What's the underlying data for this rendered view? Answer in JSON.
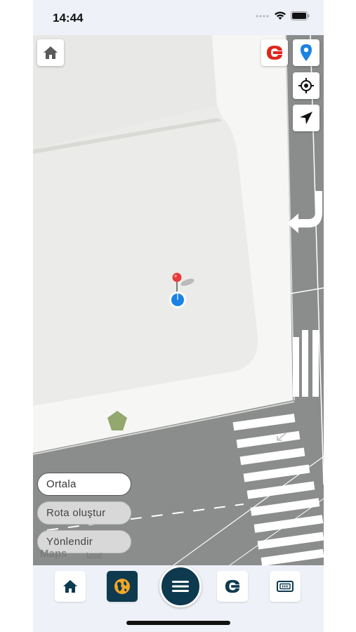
{
  "status_bar": {
    "time": "14:44",
    "icons": [
      "signal-dots-icon",
      "wifi-icon",
      "battery-icon"
    ]
  },
  "map": {
    "top_left_button_icon": "home-icon",
    "right_buttons": [
      "brand-logo-icon",
      "location-pin-icon",
      "crosshair-icon",
      "navigation-arrow-icon"
    ],
    "markers": [
      "red-pin-icon",
      "user-location-dot-icon"
    ],
    "attribution": {
      "logo": "Maps",
      "legal": "Legal"
    }
  },
  "actions": {
    "center_label": "Ortala",
    "route_label": "Rota oluştur",
    "direct_label": "Yönlendir"
  },
  "tabbar": {
    "items": [
      "home-icon",
      "globe-icon",
      "menu-icon",
      "brand-logo-icon",
      "ticket-icon"
    ]
  },
  "colors": {
    "accent_dark": "#0e3a4f",
    "globe_orange": "#f5a623",
    "brand_red": "#e1251b",
    "pin_blue": "#1a82e2",
    "road_gray": "#8a8d8c"
  }
}
